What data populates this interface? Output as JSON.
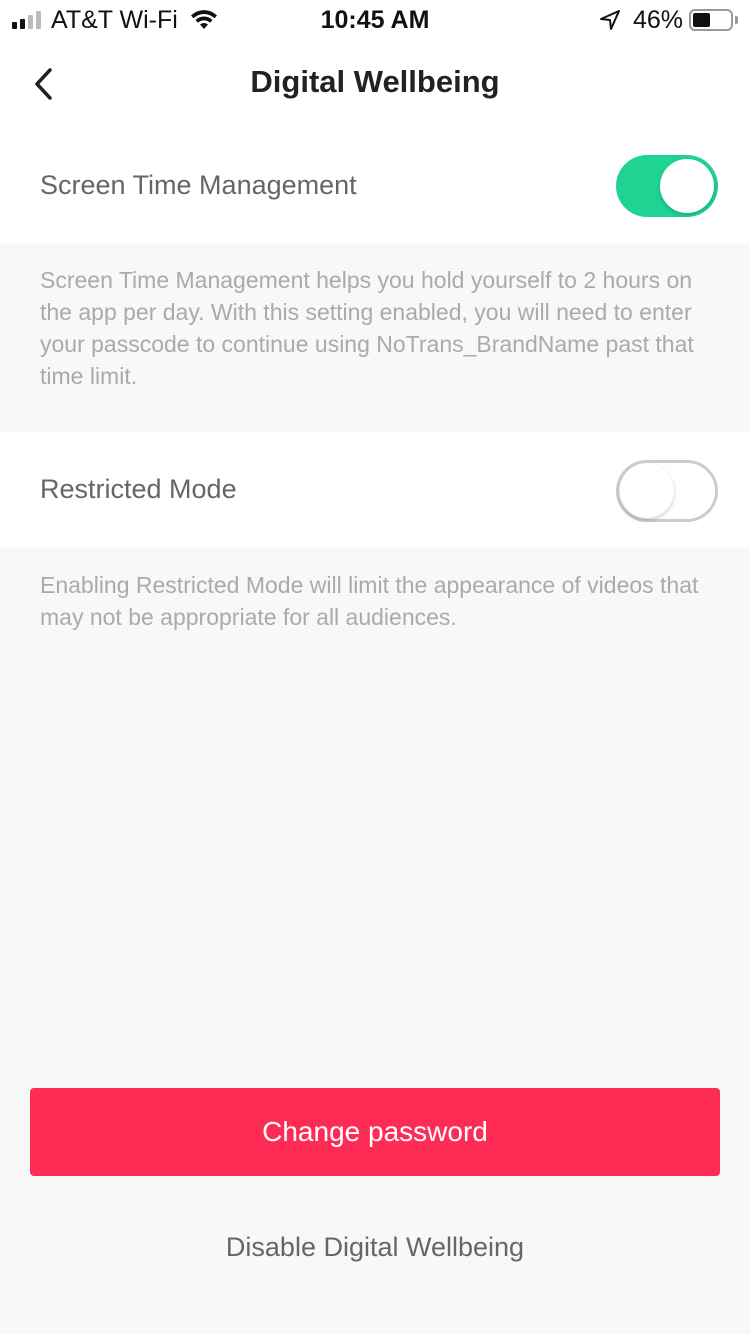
{
  "status_bar": {
    "carrier": "AT&T Wi-Fi",
    "time": "10:45 AM",
    "battery_percent": "46%",
    "battery_level": 0.46,
    "signal_bars_active": 2,
    "signal_bars_total": 4,
    "icons": [
      "signal-icon",
      "wifi-icon",
      "location-arrow-icon",
      "battery-icon"
    ]
  },
  "nav": {
    "title": "Digital Wellbeing",
    "back_icon": "chevron-left-icon"
  },
  "settings": [
    {
      "label": "Screen Time Management",
      "enabled": true,
      "description": "Screen Time Management helps you hold yourself to 2 hours on the app per day. With this setting enabled, you will need to enter your passcode to continue using NoTrans_BrandName past that time limit."
    },
    {
      "label": "Restricted Mode",
      "enabled": false,
      "description": "Enabling Restricted Mode will limit the appearance of videos that may not be appropriate for all audiences."
    }
  ],
  "actions": {
    "change_password": "Change password",
    "disable": "Disable Digital Wellbeing"
  },
  "colors": {
    "accent": "#fe2c55",
    "toggle_on": "#1fd492",
    "background": "#f8f8f8"
  }
}
